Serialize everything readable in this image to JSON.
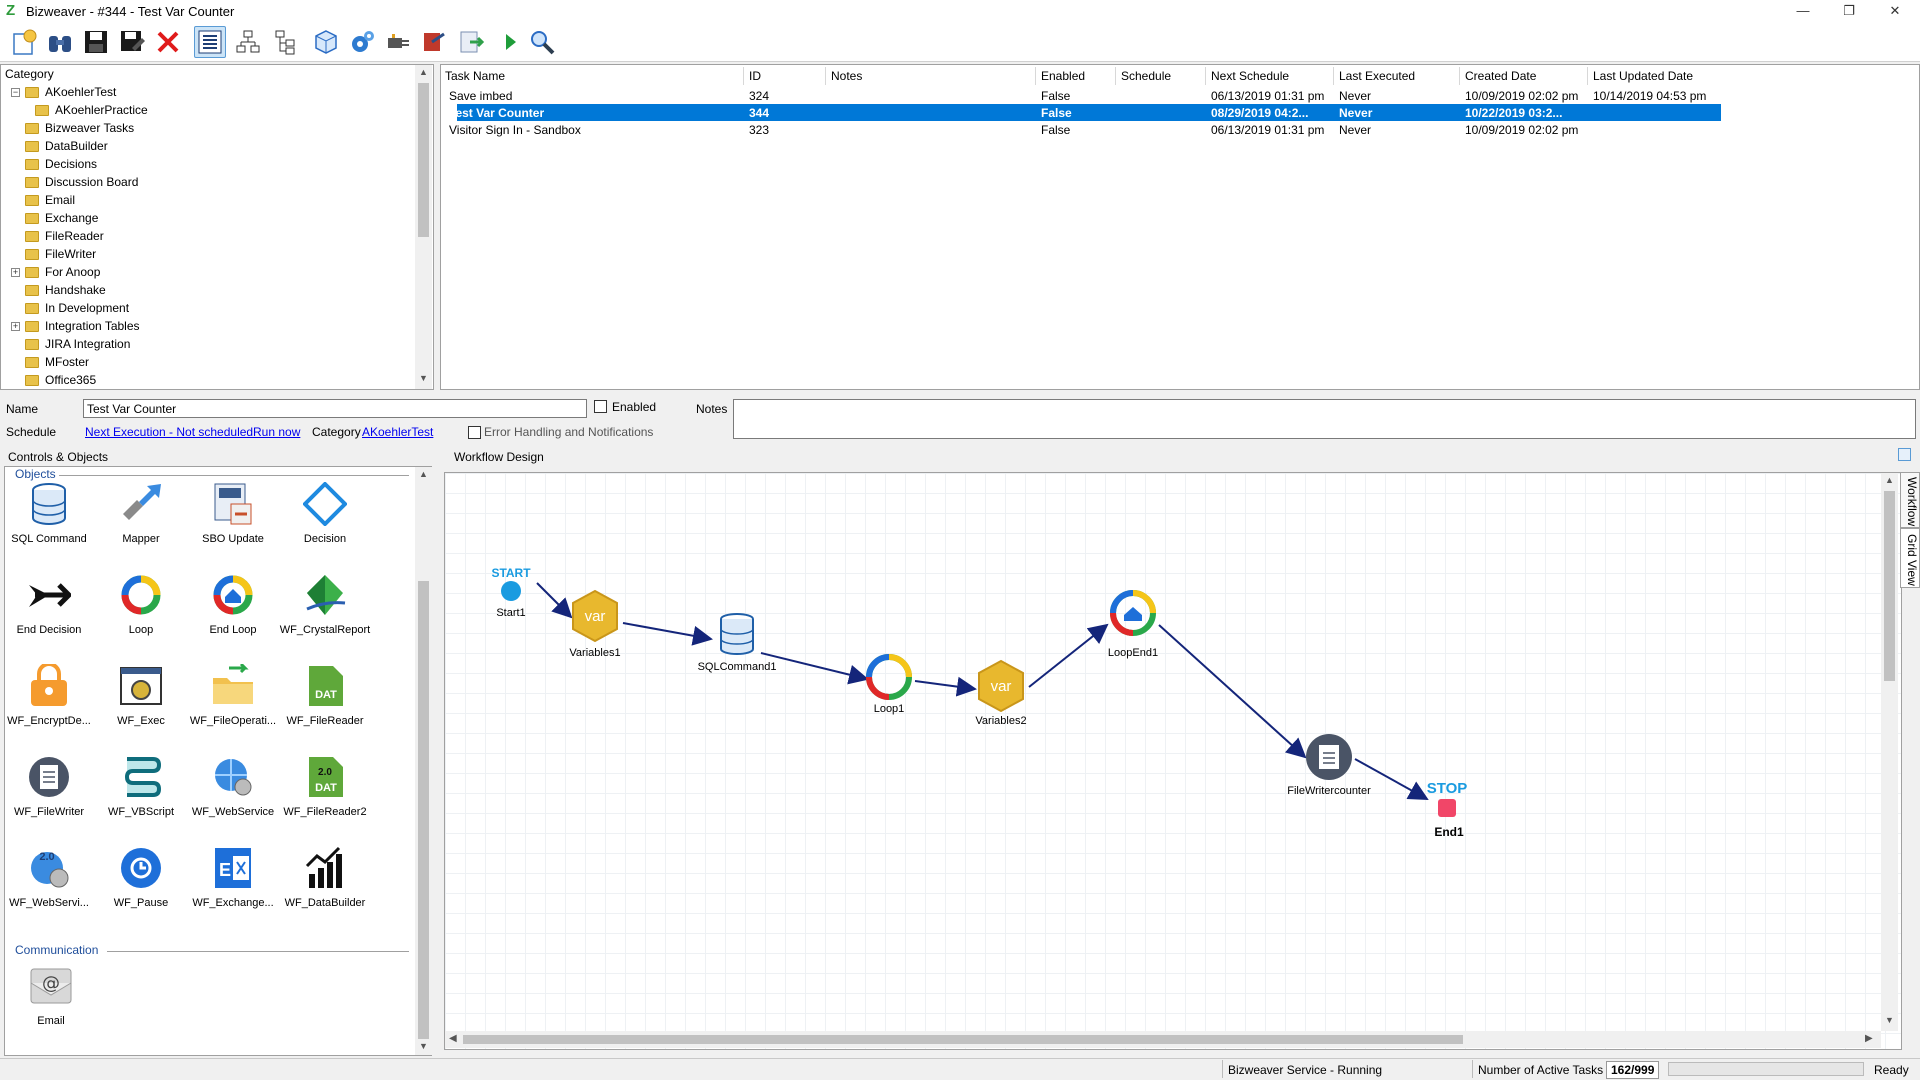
{
  "window": {
    "title": "Bizweaver - #344 - Test Var Counter",
    "min": "—",
    "restore": "❐",
    "close": "✕"
  },
  "toolbar": {
    "icons": [
      "new-workflow-icon",
      "find-icon",
      "save-icon",
      "save-as-icon",
      "delete-icon",
      "list-view-icon",
      "workflow-view-icon",
      "tree-view-icon",
      "cube-icon",
      "settings-icon",
      "plugin-icon",
      "import-icon",
      "export-icon",
      "run-icon",
      "search-icon"
    ]
  },
  "category": {
    "header": "Category",
    "items": [
      {
        "label": "AKoehlerTest",
        "level": 0,
        "expanded": true
      },
      {
        "label": "AKoehlerPractice",
        "level": 1
      },
      {
        "label": "Bizweaver Tasks",
        "level": 0
      },
      {
        "label": "DataBuilder",
        "level": 0
      },
      {
        "label": "Decisions",
        "level": 0
      },
      {
        "label": "Discussion Board",
        "level": 0
      },
      {
        "label": "Email",
        "level": 0
      },
      {
        "label": "Exchange",
        "level": 0
      },
      {
        "label": "FileReader",
        "level": 0
      },
      {
        "label": "FileWriter",
        "level": 0
      },
      {
        "label": "For Anoop",
        "level": 0,
        "collapsed": true
      },
      {
        "label": "Handshake",
        "level": 0
      },
      {
        "label": "In Development",
        "level": 0
      },
      {
        "label": "Integration Tables",
        "level": 0,
        "collapsed": true
      },
      {
        "label": "JIRA Integration",
        "level": 0
      },
      {
        "label": "MFoster",
        "level": 0
      },
      {
        "label": "Office365",
        "level": 0
      }
    ]
  },
  "grid": {
    "columns": [
      "Task Name",
      "ID",
      "Notes",
      "Enabled",
      "Schedule",
      "Next Schedule",
      "Last Executed",
      "Created Date",
      "Last Updated Date"
    ],
    "rows": [
      {
        "name": "Save imbed",
        "id": "324",
        "notes": "",
        "enabled": "False",
        "schedule": "",
        "next": "06/13/2019 01:31 pm",
        "last": "Never",
        "created": "10/09/2019 02:02 pm",
        "updated": "10/14/2019 04:53 pm"
      },
      {
        "name": "Test Var Counter",
        "id": "344",
        "notes": "",
        "enabled": "False",
        "schedule": "",
        "next": "08/29/2019 04:2...",
        "last": "Never",
        "created": "10/22/2019 03:2...",
        "updated": "",
        "selected": true
      },
      {
        "name": "Visitor Sign In - Sandbox",
        "id": "323",
        "notes": "",
        "enabled": "False",
        "schedule": "",
        "next": "06/13/2019 01:31 pm",
        "last": "Never",
        "created": "10/09/2019 02:02 pm",
        "updated": ""
      }
    ]
  },
  "form": {
    "name_label": "Name",
    "name_value": "Test Var Counter",
    "enabled_label": "Enabled",
    "notes_label": "Notes",
    "schedule_label": "Schedule",
    "next_execution": "Next Execution - Not scheduled",
    "run_now": "Run now",
    "category_label": "Category",
    "category_value": "AKoehlerTest",
    "error_handling": "Error Handling and Notifications"
  },
  "controls": {
    "header": "Controls & Objects",
    "objects_group": "Objects",
    "communication_group": "Communication",
    "objects": [
      {
        "label": "SQL Command",
        "icon": "database-icon"
      },
      {
        "label": "Mapper",
        "icon": "mapper-icon"
      },
      {
        "label": "SBO Update",
        "icon": "sbo-update-icon"
      },
      {
        "label": "Decision",
        "icon": "decision-icon"
      },
      {
        "label": "End Decision",
        "icon": "end-decision-icon"
      },
      {
        "label": "Loop",
        "icon": "loop-icon"
      },
      {
        "label": "End Loop",
        "icon": "end-loop-icon"
      },
      {
        "label": "WF_CrystalReport",
        "icon": "crystal-report-icon"
      },
      {
        "label": "WF_EncryptDe...",
        "icon": "encrypt-icon"
      },
      {
        "label": "WF_Exec",
        "icon": "exec-icon"
      },
      {
        "label": "WF_FileOperati...",
        "icon": "file-operations-icon"
      },
      {
        "label": "WF_FileReader",
        "icon": "file-reader-icon",
        "badge": "DAT"
      },
      {
        "label": "WF_FileWriter",
        "icon": "file-writer-icon"
      },
      {
        "label": "WF_VBScript",
        "icon": "vbscript-icon"
      },
      {
        "label": "WF_WebService",
        "icon": "web-service-icon"
      },
      {
        "label": "WF_FileReader2",
        "icon": "file-reader2-icon",
        "badge": "DAT",
        "version": "2.0"
      },
      {
        "label": "WF_WebServi...",
        "icon": "web-service2-icon",
        "version": "2.0"
      },
      {
        "label": "WF_Pause",
        "icon": "pause-icon"
      },
      {
        "label": "WF_Exchange...",
        "icon": "exchange-icon"
      },
      {
        "label": "WF_DataBuilder",
        "icon": "databuilder-icon"
      }
    ],
    "communication": [
      {
        "label": "Email",
        "icon": "email-icon"
      }
    ]
  },
  "design": {
    "header": "Workflow Design",
    "tabs": [
      "Workflow",
      "Grid View"
    ],
    "start_text": "START",
    "stop_text": "STOP",
    "var_text": "var",
    "nodes": [
      {
        "id": "start",
        "label": "Start1"
      },
      {
        "id": "var1",
        "label": "Variables1"
      },
      {
        "id": "sql1",
        "label": "SQLCommand1"
      },
      {
        "id": "loop1",
        "label": "Loop1"
      },
      {
        "id": "var2",
        "label": "Variables2"
      },
      {
        "id": "loopend",
        "label": "LoopEnd1"
      },
      {
        "id": "fw",
        "label": "FileWritercounter"
      },
      {
        "id": "end",
        "label": "End1"
      }
    ]
  },
  "status": {
    "service": "Bizweaver Service - Running",
    "active_label": "Number of Active Tasks",
    "active_value": "162/999",
    "ready": "Ready"
  },
  "colors": {
    "selection": "#0078d7",
    "link": "#0000ee",
    "start": "#1a9be0",
    "stop": "#f14668",
    "arrow": "#14257a",
    "var_hex": "#e8b82e"
  }
}
